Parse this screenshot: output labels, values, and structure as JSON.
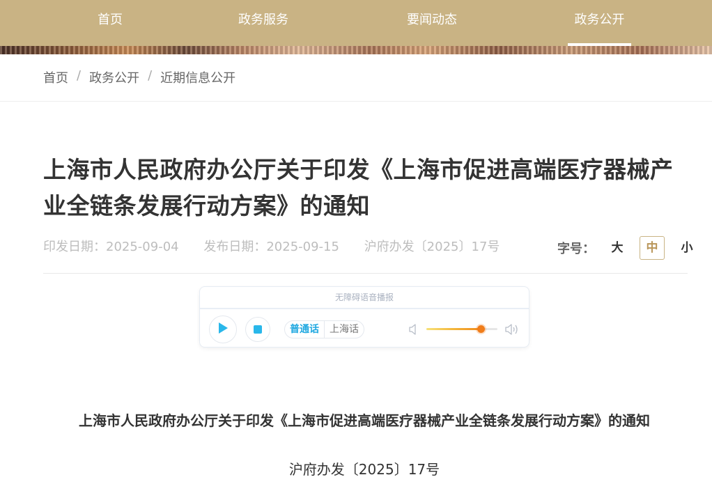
{
  "nav": {
    "items": [
      {
        "label": "首页",
        "active": false
      },
      {
        "label": "政务服务",
        "active": false
      },
      {
        "label": "要闻动态",
        "active": false
      },
      {
        "label": "政务公开",
        "active": true
      }
    ]
  },
  "breadcrumb": [
    "首页",
    "政务公开",
    "近期信息公开"
  ],
  "article": {
    "title": "上海市人民政府办公厅关于印发《上海市促进高端医疗器械产业全链条发展行动方案》的通知",
    "issue_date": "印发日期：2025-09-04",
    "publish_date": "发布日期：2025-09-15",
    "doc_number": "沪府办发〔2025〕17号"
  },
  "font_size": {
    "label": "字号：",
    "options": [
      "大",
      "中",
      "小"
    ],
    "selected": "中"
  },
  "player": {
    "title": "无障碍语音播报",
    "play_icon": "play-icon",
    "stop_icon": "stop-icon",
    "dialects": [
      "普通话",
      "上海话"
    ],
    "selected_dialect": "普通话",
    "volume": 0.76
  },
  "body": {
    "heading": "上海市人民政府办公厅关于印发《上海市促进高端医疗器械产业全链条发展行动方案》的通知",
    "doc_number": "沪府办发〔2025〕17号"
  },
  "colors": {
    "nav_bg": "#c9b384",
    "accent": "#1fa8e0",
    "volume_knob": "#f07d1a"
  }
}
